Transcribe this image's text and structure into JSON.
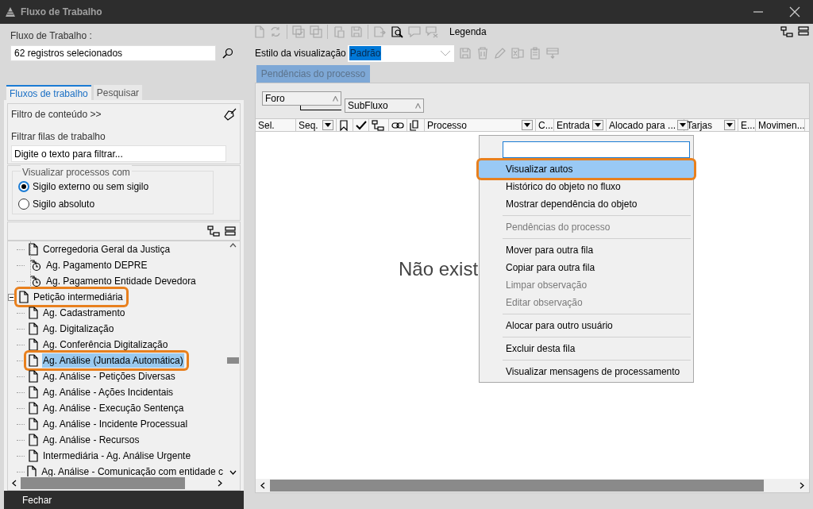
{
  "window": {
    "title": "Fluxo de Trabalho"
  },
  "left": {
    "workflow_label": "Fluxo de Trabalho :",
    "workflow_value": "62 registros selecionados",
    "tabs": [
      {
        "label": "Fluxos de trabalho",
        "selected": true
      },
      {
        "label": "Pesquisar",
        "selected": false
      }
    ],
    "content_filter": "Filtro de conteúdo >>",
    "filter_label": "Filtrar filas de trabalho",
    "filter_placeholder": "Digite o texto para filtrar...",
    "visibility": {
      "legend": "Visualizar processos com",
      "options": [
        {
          "label": "Sigilo externo ou sem sigilo",
          "selected": true
        },
        {
          "label": "Sigilo absoluto",
          "selected": false
        }
      ]
    },
    "tree": [
      {
        "children": [
          {
            "label": "Corregedoria Geral da Justiça",
            "kind": "queue",
            "selected": false,
            "highlighted": false
          },
          {
            "label": "Ag. Pagamento DEPRE",
            "kind": "timer",
            "selected": false,
            "highlighted": false
          },
          {
            "label": "Ag. Pagamento Entidade Devedora",
            "kind": "timer",
            "selected": false,
            "highlighted": false
          }
        ]
      },
      {
        "label": "Petição intermediária",
        "kind": "queue",
        "expanded": true,
        "selected": false,
        "highlighted": true,
        "children": [
          {
            "label": "Ag. Cadastramento",
            "kind": "queue",
            "selected": false,
            "highlighted": false
          },
          {
            "label": "Ag. Digitalização",
            "kind": "queue",
            "selected": false,
            "highlighted": false
          },
          {
            "label": "Ag. Conferência Digitalização",
            "kind": "queue",
            "selected": false,
            "highlighted": false
          },
          {
            "label": "Ag. Análise (Juntada Automática)",
            "kind": "queue",
            "selected": true,
            "highlighted": true
          },
          {
            "label": "Ag. Análise - Petições Diversas",
            "kind": "queue",
            "selected": false,
            "highlighted": false
          },
          {
            "label": "Ag. Análise - Ações Incidentais",
            "kind": "queue",
            "selected": false,
            "highlighted": false
          },
          {
            "label": "Ag. Análise - Execução Sentença",
            "kind": "queue",
            "selected": false,
            "highlighted": false
          },
          {
            "label": "Ag. Análise - Incidente Processual",
            "kind": "queue",
            "selected": false,
            "highlighted": false
          },
          {
            "label": "Ag. Análise - Recursos",
            "kind": "queue",
            "selected": false,
            "highlighted": false
          },
          {
            "label": "Intermediária - Ag. Análise Urgente",
            "kind": "queue",
            "selected": false,
            "highlighted": false
          },
          {
            "label": "Ag. Análise - Comunicação com entidade c",
            "kind": "queue",
            "selected": false,
            "highlighted": false
          }
        ]
      }
    ],
    "close_button": "Fechar"
  },
  "right": {
    "legend": "Legenda",
    "view_style": {
      "label": "Estilo da visualização",
      "value": "Padrão"
    },
    "tab": "Pendências do processo",
    "group_by": [
      {
        "label": "Foro"
      },
      {
        "label": "SubFluxo"
      }
    ],
    "columns": [
      {
        "kind": "text",
        "label": "Sel.",
        "filter": false
      },
      {
        "kind": "text",
        "label": "Seq.",
        "filter": true
      },
      {
        "kind": "bookmark"
      },
      {
        "kind": "check"
      },
      {
        "kind": "tree"
      },
      {
        "kind": "link"
      },
      {
        "kind": "copy"
      },
      {
        "kind": "text",
        "label": "Processo",
        "filter": true
      },
      {
        "kind": "text",
        "label": "C..."
      },
      {
        "kind": "text",
        "label": "Entrada",
        "filter": true
      },
      {
        "kind": "text",
        "label": "Alocado para ...",
        "filter": true
      },
      {
        "kind": "text",
        "label": "Tarjas",
        "filter": true
      },
      {
        "kind": "text",
        "label": "E..."
      },
      {
        "kind": "text",
        "label": "Movimen..."
      }
    ],
    "empty_message": "Não exist",
    "context_menu": {
      "items": [
        {
          "kind": "item",
          "label": "Visualizar autos",
          "disabled": false,
          "highlighted": true
        },
        {
          "kind": "item",
          "label": "Histórico do objeto no fluxo",
          "disabled": false,
          "highlighted": false
        },
        {
          "kind": "item",
          "label": "Mostrar dependência do objeto",
          "disabled": false,
          "highlighted": false
        },
        {
          "kind": "separator"
        },
        {
          "kind": "item",
          "label": "Pendências do processo",
          "disabled": true,
          "highlighted": false
        },
        {
          "kind": "separator"
        },
        {
          "kind": "item",
          "label": "Mover para outra fila",
          "disabled": false,
          "highlighted": false
        },
        {
          "kind": "item",
          "label": "Copiar para outra fila",
          "disabled": false,
          "highlighted": false
        },
        {
          "kind": "item",
          "label": "Limpar observação",
          "disabled": true,
          "highlighted": false
        },
        {
          "kind": "item",
          "label": "Editar observação",
          "disabled": true,
          "highlighted": false
        },
        {
          "kind": "separator"
        },
        {
          "kind": "item",
          "label": "Alocar para outro usuário",
          "disabled": false,
          "highlighted": false
        },
        {
          "kind": "separator"
        },
        {
          "kind": "item",
          "label": "Excluir desta fila",
          "disabled": false,
          "highlighted": false
        },
        {
          "kind": "separator"
        },
        {
          "kind": "item",
          "label": "Visualizar mensagens de processamento",
          "disabled": false,
          "highlighted": false
        }
      ]
    }
  }
}
